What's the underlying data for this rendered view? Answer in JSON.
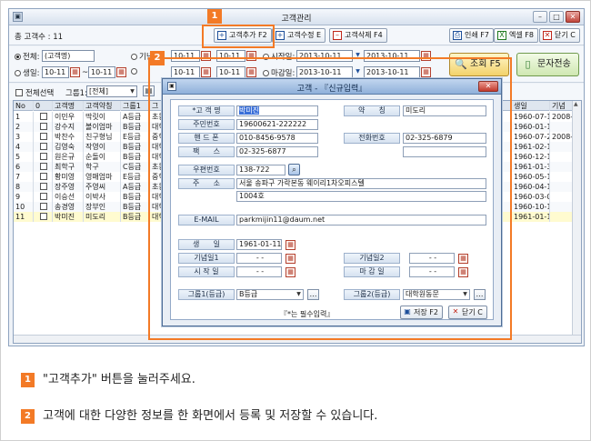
{
  "window": {
    "title": "고객관리",
    "icon": "window-icon"
  },
  "toolbar": {
    "count_label": "총 고객수 : 11",
    "add_label": "고객추가 F2",
    "edit_label": "고객수정 E",
    "delete_label": "고객삭제 F4",
    "print_label": "인쇄 F7",
    "excel_label": "엑셀 F8",
    "close_label": "닫기 C"
  },
  "filters": {
    "all_label": "전체:",
    "all_value": "(고객명)",
    "birthday_label": "생일:",
    "birth_from": "10-11",
    "birth_to": "10-11",
    "tilde": "~",
    "anniversary_label": "기념일:",
    "anniv_from": "10-11",
    "anniv_to": "10-11",
    "start_label": "시작일:",
    "start_from": "2013-10-11",
    "start_to": "2013-10-11",
    "end_label": "마감일:",
    "end_from": "2013-10-11",
    "end_to": "2013-10-11",
    "search_label": "조회 F5",
    "sms_label": "문자전송"
  },
  "gridbar": {
    "select_all_label": "전체선택",
    "group_label": "그룹1:",
    "group_value": "[전체]"
  },
  "grid": {
    "headers": [
      "No",
      "0",
      "고객명",
      "고객약칭",
      "그룹1",
      "그",
      "생일",
      "기념"
    ],
    "rows": [
      {
        "no": "1",
        "name": "이민우",
        "nick": "딱릿이",
        "group": "A등급",
        "g2": "초등학",
        "birth": "1960-07-18",
        "anniv": "2008-"
      },
      {
        "no": "2",
        "name": "강수지",
        "nick": "볼이엄마",
        "group": "B등급",
        "g2": "대학원",
        "birth": "1960-01-11",
        "anniv": ""
      },
      {
        "no": "3",
        "name": "박찬수",
        "nick": "친구형님",
        "group": "E등급",
        "g2": "중학교",
        "birth": "1960-07-23",
        "anniv": "2008-"
      },
      {
        "no": "4",
        "name": "김영숙",
        "nick": "작영이",
        "group": "B등급",
        "g2": "대학교",
        "birth": "1961-02-14",
        "anniv": ""
      },
      {
        "no": "5",
        "name": "원은규",
        "nick": "순돌이",
        "group": "B등급",
        "g2": "대학교",
        "birth": "1960-12-12",
        "anniv": ""
      },
      {
        "no": "6",
        "name": "최학구",
        "nick": "학구",
        "group": "C등급",
        "g2": "초등학",
        "birth": "1961-01-31",
        "anniv": ""
      },
      {
        "no": "7",
        "name": "황미영",
        "nick": "영매엄마",
        "group": "E등급",
        "g2": "중학교",
        "birth": "1960-05-14",
        "anniv": ""
      },
      {
        "no": "8",
        "name": "장주영",
        "nick": "주영씨",
        "group": "A등급",
        "g2": "초등학",
        "birth": "1960-04-14",
        "anniv": ""
      },
      {
        "no": "9",
        "name": "이승선",
        "nick": "이박사",
        "group": "B등급",
        "g2": "대학원",
        "birth": "1960-03-02",
        "anniv": ""
      },
      {
        "no": "10",
        "name": "송경영",
        "nick": "장부인",
        "group": "B등급",
        "g2": "대학교",
        "birth": "1960-10-11",
        "anniv": ""
      },
      {
        "no": "11",
        "name": "박미진",
        "nick": "미도리",
        "group": "B등급",
        "g2": "대학원",
        "birth": "1961-01-11",
        "anniv": ""
      }
    ]
  },
  "modal": {
    "title": "고객 - 『신규입력』",
    "labels": {
      "name": "*고 객 명",
      "alias": "약      칭",
      "ssn": "주민번호",
      "mobile": "핸 드 폰",
      "phone": "전화번호",
      "fax": "팩      스",
      "zip": "우편번호",
      "address": "주      소",
      "email": "E-MAIL",
      "birthday": "생      일",
      "anniv1": "기념일1",
      "anniv2": "기념일2",
      "start": "시 작 일",
      "end": "마 감 일",
      "group1": "그룹1(등급)",
      "group2": "그룹2(등급)"
    },
    "values": {
      "name": "박미진",
      "alias": "미도리",
      "ssn": "19600621-222222",
      "mobile": "010-8456-9578",
      "phone": "02-325-6879",
      "fax": "02-325-6877",
      "zip": "138-722",
      "address1": "서울 송파구 가락본동 웨이리1차오피스텔",
      "address2": "1004호",
      "email": "parkmijin11@daum.net",
      "birthday": "1961-01-11",
      "anniv1": "- -",
      "anniv2": "- -",
      "start": "- -",
      "end": "- -",
      "group1": "B등급",
      "group2": "대학원동문"
    },
    "required_note": "『*는 필수입력』",
    "save_label": "저장 F2",
    "close_label": "닫기 C"
  },
  "callouts": {
    "one": "1",
    "two": "2"
  },
  "instructions": [
    {
      "num": "1",
      "text": "\"고객추가\" 버튼을 눌러주세요."
    },
    {
      "num": "2",
      "text": "고객에 대한 다양한 정보를 한 화면에서 등록 및 저장할 수 있습니다."
    }
  ],
  "colors": {
    "accent": "#f37a26",
    "window_border": "#8ea3bf",
    "modal_title": "#8fb0da"
  }
}
